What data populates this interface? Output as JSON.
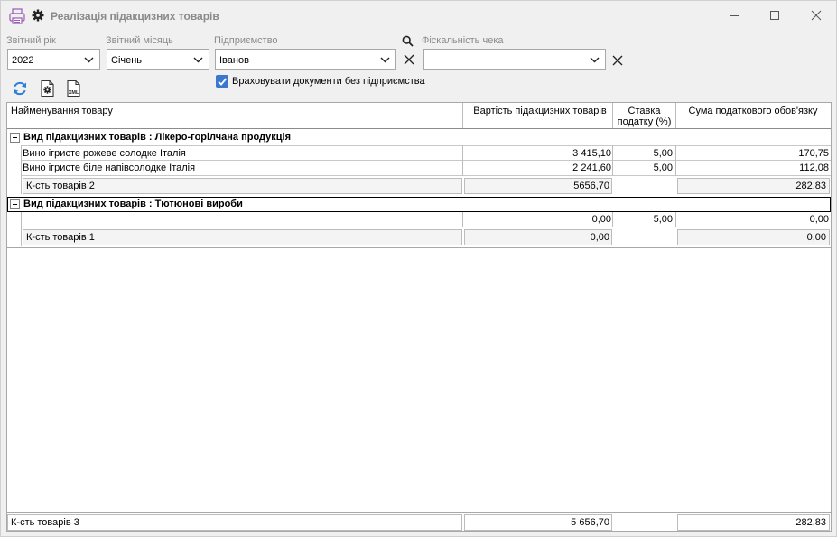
{
  "window": {
    "title": "Реалізація підакцизних товарів",
    "icons": {
      "app": "printer-icon",
      "settings": "gear-icon",
      "minimize": "minimize-icon",
      "maximize": "maximize-icon",
      "close": "close-icon"
    }
  },
  "filters": {
    "year_label": "Звітний рік",
    "year_value": "2022",
    "month_label": "Звітний місяць",
    "month_value": "Січень",
    "company_label": "Підприємство",
    "company_value": "Іванов",
    "fiscal_label": "Фіскальність чека",
    "fiscal_value": "",
    "include_without_company_label": "Враховувати документи без підприємства",
    "include_without_company_checked": true
  },
  "toolbar": {
    "icons": [
      "refresh-icon",
      "settings-document-icon",
      "xml-export-icon"
    ]
  },
  "colors": {
    "accent": "#3a78d0",
    "label_gray": "#8a8a8a"
  },
  "grid": {
    "columns": {
      "name": "Найменування товару",
      "cost": "Вартість підакцизних товарів",
      "rate_line1": "Ставка",
      "rate_line2": "податку (%)",
      "tax": "Сума податкового обов'язку"
    },
    "groups": [
      {
        "title": "Вид підакцизних товарів : Лікеро-горілчана продукція",
        "rows": [
          {
            "name": "Вино ігристе рожеве солодке Італія",
            "cost": "3 415,10",
            "rate": "5,00",
            "tax": "170,75"
          },
          {
            "name": "Вино ігристе біле напівсолодке Італія",
            "cost": "2 241,60",
            "rate": "5,00",
            "tax": "112,08"
          }
        ],
        "summary": {
          "label": "К-сть товарів 2",
          "cost": "5656,70",
          "tax": "282,83"
        }
      },
      {
        "title": "Вид підакцизних товарів : Тютюнові вироби",
        "rows": [
          {
            "name": "",
            "cost": "0,00",
            "rate": "5,00",
            "tax": "0,00"
          }
        ],
        "summary": {
          "label": "К-сть товарів 1",
          "cost": "0,00",
          "tax": "0,00"
        }
      }
    ],
    "footer": {
      "label": "К-сть товарів  3",
      "cost": "5 656,70",
      "tax": "282,83"
    }
  }
}
